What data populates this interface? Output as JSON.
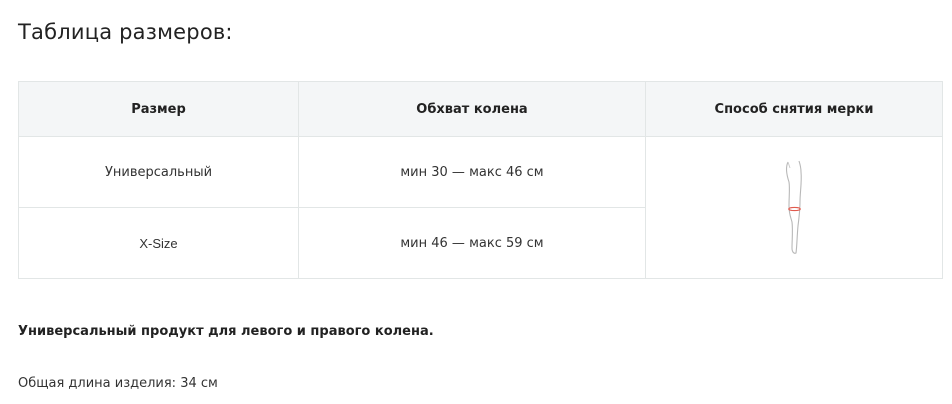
{
  "page_title": "Таблица размеров:",
  "table": {
    "headers": [
      "Размер",
      "Обхват колена",
      "Способ снятия мерки"
    ],
    "rows": [
      {
        "size": "Универсальный",
        "circumference": "мин 30 — макс 46 см"
      },
      {
        "size": "X-Size",
        "circumference": "мин 46 — макс 59 см"
      }
    ],
    "measure_image": "leg-measurement-illustration",
    "measure_marker_color": "#e05a4e"
  },
  "notes": {
    "universal": "Универсальный продукт для левого и правого колена.",
    "length": "Общая длина изделия: 34 см"
  }
}
